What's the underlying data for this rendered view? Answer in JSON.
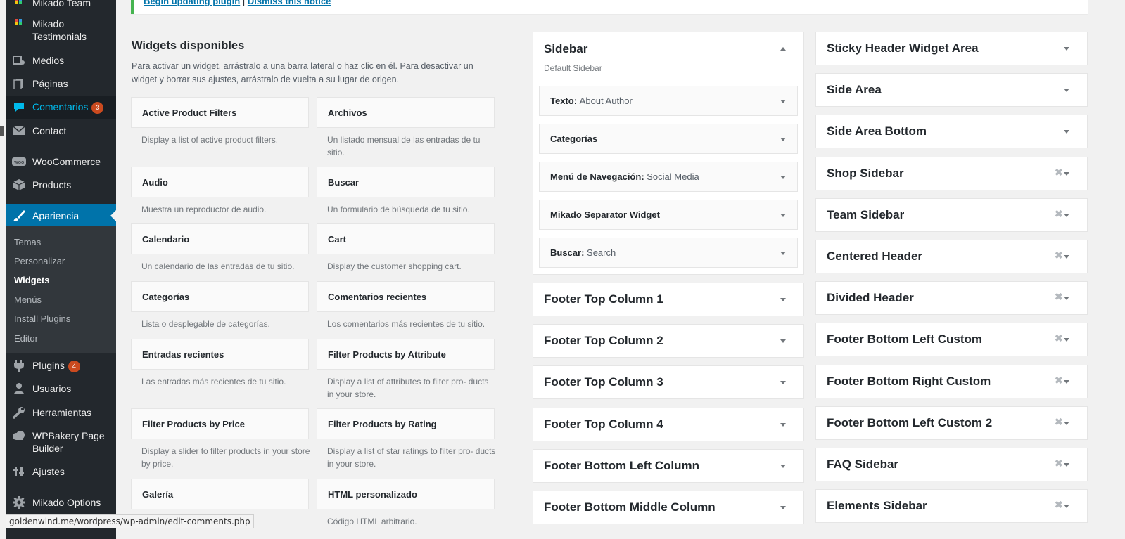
{
  "notice": {
    "link1": "Begin updating plugin",
    "separator": "|",
    "link2": "Dismiss this notice"
  },
  "admin_menu": [
    {
      "label": "Mikado Team",
      "icon": "grid-icon"
    },
    {
      "label": "Mikado Testimonials",
      "icon": "grid-icon"
    },
    {
      "label": "Medios",
      "icon": "media-icon"
    },
    {
      "label": "Páginas",
      "icon": "page-icon"
    },
    {
      "label": "Comentarios",
      "icon": "comment-icon",
      "count": "3"
    },
    {
      "label": "Contact",
      "icon": "mail-icon"
    },
    {
      "label": "WooCommerce",
      "icon": "woocommerce-icon"
    },
    {
      "label": "Products",
      "icon": "box-icon"
    },
    {
      "label": "Apariencia",
      "icon": "brush-icon"
    },
    {
      "label": "Plugins",
      "icon": "plugin-icon",
      "count": "4"
    },
    {
      "label": "Usuarios",
      "icon": "user-icon"
    },
    {
      "label": "Herramientas",
      "icon": "wrench-icon"
    },
    {
      "label": "WPBakery Page Builder",
      "icon": "cloud-icon"
    },
    {
      "label": "Ajustes",
      "icon": "settings-icon"
    },
    {
      "label": "Mikado Options",
      "icon": "gear-icon"
    }
  ],
  "submenu": [
    "Temas",
    "Personalizar",
    "Widgets",
    "Menús",
    "Install Plugins",
    "Editor"
  ],
  "available": {
    "title": "Widgets disponibles",
    "description": "Para activar un widget, arrástralo a una barra lateral o haz clic en él. Para desactivar un widget y borrar sus ajustes, arrástralo de vuelta a su lugar de origen.",
    "widgets": [
      {
        "name": "Active Product Filters",
        "desc": "Display a list of active product filters."
      },
      {
        "name": "Archivos",
        "desc": "Un listado mensual de las entradas de tu sitio."
      },
      {
        "name": "Audio",
        "desc": "Muestra un reproductor de audio."
      },
      {
        "name": "Buscar",
        "desc": "Un formulario de búsqueda de tu sitio."
      },
      {
        "name": "Calendario",
        "desc": "Un calendario de las entradas de tu sitio."
      },
      {
        "name": "Cart",
        "desc": "Display the customer shopping cart."
      },
      {
        "name": "Categorías",
        "desc": "Lista o desplegable de categorías."
      },
      {
        "name": "Comentarios recientes",
        "desc": "Los comentarios más recientes de tu sitio."
      },
      {
        "name": "Entradas recientes",
        "desc": "Las entradas más recientes de tu sitio."
      },
      {
        "name": "Filter Products by Attribute",
        "desc": "Display a list of attributes to filter pro- ducts in your store."
      },
      {
        "name": "Filter Products by Price",
        "desc": "Display a slider to filter products in your store by price."
      },
      {
        "name": "Filter Products by Rating",
        "desc": "Display a list of star ratings to filter pro- ducts in your store."
      },
      {
        "name": "Galería",
        "desc": ""
      },
      {
        "name": "HTML personalizado",
        "desc": "Código HTML arbitrario."
      }
    ]
  },
  "sidebar_main": {
    "title": "Sidebar",
    "description": "Default Sidebar",
    "widgets": [
      {
        "type": "Texto",
        "title": "About Author"
      },
      {
        "type": "Categorías",
        "title": ""
      },
      {
        "type": "Menú de Navegación",
        "title": "Social Media"
      },
      {
        "type": "Mikado Separator Widget",
        "title": ""
      },
      {
        "type": "Buscar",
        "title": "Search"
      }
    ]
  },
  "middle_areas": [
    "Footer Top Column 1",
    "Footer Top Column 2",
    "Footer Top Column 3",
    "Footer Top Column 4",
    "Footer Bottom Left Column",
    "Footer Bottom Middle Column"
  ],
  "right_areas": [
    {
      "title": "Sticky Header Widget Area",
      "removable": false
    },
    {
      "title": "Side Area",
      "removable": false
    },
    {
      "title": "Side Area Bottom",
      "removable": false
    },
    {
      "title": "Shop Sidebar",
      "removable": true
    },
    {
      "title": "Team Sidebar",
      "removable": true
    },
    {
      "title": "Centered Header",
      "removable": true
    },
    {
      "title": "Divided Header",
      "removable": true
    },
    {
      "title": "Footer Bottom Left Custom",
      "removable": true
    },
    {
      "title": "Footer Bottom Right Custom",
      "removable": true
    },
    {
      "title": "Footer Bottom Left Custom 2",
      "removable": true
    },
    {
      "title": "FAQ Sidebar",
      "removable": true
    },
    {
      "title": "Elements Sidebar",
      "removable": true
    }
  ],
  "status_bar": {
    "url": "goldenwind.me/wordpress/wp-admin/edit-comments.php"
  },
  "colors": {
    "accent": "#0073aa",
    "menu_bg": "#23282d",
    "submenu_bg": "#32373c",
    "hover_text": "#00b9eb",
    "badge": "#ca4a1f",
    "notice_border": "#46b450"
  }
}
